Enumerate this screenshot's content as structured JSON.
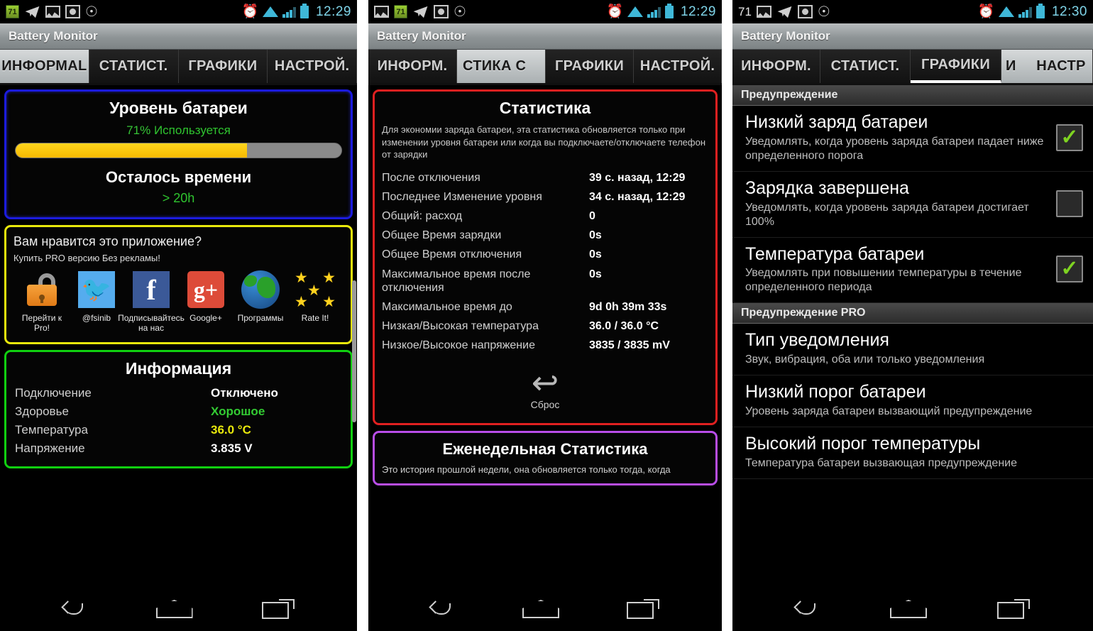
{
  "panels": [
    {
      "statusbar": {
        "battery_badge": "71",
        "icons": [
          "battery-badge-icon",
          "telegram-icon",
          "gallery-icon",
          "camera-icon",
          "whatsapp-icon"
        ],
        "right_icons": [
          "alarm-icon",
          "wifi-icon",
          "signal-icon",
          "battery-icon"
        ],
        "time": "12:29"
      },
      "appbar": {
        "title": "Battery Monitor"
      },
      "tabs": [
        {
          "label": "ИНФОРМАL",
          "selected": true
        },
        {
          "label": "СТАТИСТ.",
          "selected": false
        },
        {
          "label": "ГРАФИКИ",
          "selected": false
        },
        {
          "label": "НАСТРОЙ.",
          "selected": false
        }
      ],
      "battery_card": {
        "title": "Уровень батареи",
        "percent_text": "71%",
        "state_text": "Используется",
        "percent_value": 71,
        "remaining_title": "Осталось времени",
        "remaining_value": "> 20h"
      },
      "promo_card": {
        "question": "Вам нравится это приложение?",
        "subtitle": "Купить PRO версию Без рекламы!",
        "items": [
          {
            "icon": "unlock-icon",
            "label": "Перейти к Pro!"
          },
          {
            "icon": "twitter-icon",
            "label": "@fsinib"
          },
          {
            "icon": "facebook-icon",
            "label": "Подписывайтесь на нас"
          },
          {
            "icon": "google-plus-icon",
            "label": "Google+"
          },
          {
            "icon": "globe-icon",
            "label": "Программы"
          },
          {
            "icon": "stars-icon",
            "label": "Rate It!"
          }
        ]
      },
      "info_card": {
        "title": "Информация",
        "rows": [
          {
            "key": "Подключение",
            "value": "Отключено",
            "color": "white"
          },
          {
            "key": "Здоровье",
            "value": "Хорошое",
            "color": "green"
          },
          {
            "key": "Температура",
            "value": "36.0 °C",
            "color": "yellow"
          },
          {
            "key": "Напряжение",
            "value": "3.835 V",
            "color": "white"
          }
        ]
      }
    },
    {
      "statusbar": {
        "battery_badge": "71",
        "time": "12:29"
      },
      "appbar": {
        "title": "Battery Monitor"
      },
      "tabs": [
        {
          "label": "ИНФОРМ.",
          "selected": false
        },
        {
          "label": "СТИКА          С",
          "selected": true
        },
        {
          "label": "ГРАФИКИ",
          "selected": false
        },
        {
          "label": "НАСТРОЙ.",
          "selected": false
        }
      ],
      "stats_card": {
        "title": "Статистика",
        "description": "Для экономии заряда батареи, эта статистика обновляется только при изменении уровня батареи или когда вы подключаете/отключаете телефон от зарядки",
        "rows": [
          {
            "key": "После отключения",
            "value": "39 с. назад, 12:29"
          },
          {
            "key": "Последнее Изменение уровня",
            "value": "34 с. назад, 12:29"
          },
          {
            "key": "Общий: расход",
            "value": "0"
          },
          {
            "key": "Общее Время зарядки",
            "value": "0s"
          },
          {
            "key": "Общее Время отключения",
            "value": "0s"
          },
          {
            "key": "Максимальное время после отключения",
            "value": "0s"
          },
          {
            "key": "Максимальное время до",
            "value": "9d 0h 39m 33s"
          },
          {
            "key": "Низкая/Высокая температура",
            "value": "36.0 / 36.0 °C"
          },
          {
            "key": "Низкое/Высокое напряжение",
            "value": "3835 / 3835 mV"
          }
        ],
        "reset_label": "Сброс",
        "reset_icon": "undo-arrow-icon"
      },
      "weekly_card": {
        "title": "Еженедельная Статистика",
        "description": "Это история прошлой недели, она обновляется только тогда, когда"
      }
    },
    {
      "statusbar": {
        "battery_badge": "71",
        "time": "12:30"
      },
      "appbar": {
        "title": "Battery Monitor"
      },
      "tabs": [
        {
          "label": "ИНФОРМ.",
          "selected": false
        },
        {
          "label": "СТАТИСТ.",
          "selected": false
        },
        {
          "label": "ГРАФИКИ",
          "selected": false,
          "underlined": true
        },
        {
          "label": "И",
          "selected": true
        },
        {
          "label": "НАСТР",
          "selected": true
        }
      ],
      "sections": [
        {
          "header": "Предупреждение",
          "items": [
            {
              "title": "Низкий заряд батареи",
              "subtitle": "Уведомлять, когда уровень заряда батареи падает ниже определенного порога",
              "checkbox": true,
              "checked": true
            },
            {
              "title": "Зарядка завершена",
              "subtitle": "Уведомлять, когда уровень заряда батареи достигает 100%",
              "checkbox": true,
              "checked": false
            },
            {
              "title": "Температура батареи",
              "subtitle": "Уведомлять при повышении температуры в течение определенного периода",
              "checkbox": true,
              "checked": true
            }
          ]
        },
        {
          "header": "Предупреждение PRO",
          "items": [
            {
              "title": "Тип уведомления",
              "subtitle": "Звук, вибрация, оба или только уведомления",
              "checkbox": false,
              "checked": false
            },
            {
              "title": "Низкий порог батареи",
              "subtitle": "Уровень заряда батареи вызвающий предупреждение",
              "checkbox": false,
              "checked": false
            },
            {
              "title": "Высокий порог температуры",
              "subtitle": "Температура батареи вызвающая предупреждение",
              "checkbox": false,
              "checked": false
            }
          ]
        }
      ]
    }
  ],
  "navbar": {
    "back": "back-icon",
    "home": "home-icon",
    "recents": "recents-icon"
  },
  "colors": {
    "accent_blue": "#1b1bdd",
    "accent_yellow": "#e8e80c",
    "accent_green": "#10d010",
    "accent_red": "#e02020",
    "accent_purple": "#b84de8",
    "battery_fill": "#ffd61e",
    "status_cyan": "#3fb8d8",
    "check_green": "#7ed321"
  }
}
